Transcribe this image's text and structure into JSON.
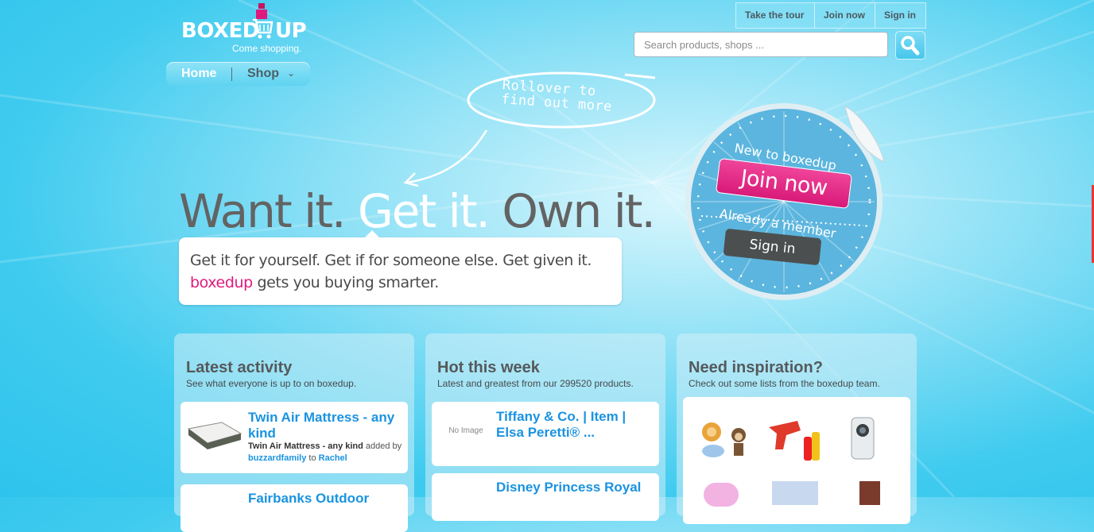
{
  "logo": {
    "word_left": "BOXED",
    "word_right": "UP",
    "tagline": "Come shopping."
  },
  "nav": {
    "home": "Home",
    "shop": "Shop"
  },
  "toplinks": {
    "tour": "Take the tour",
    "join": "Join now",
    "signin": "Sign in"
  },
  "search": {
    "placeholder": "Search products, shops ..."
  },
  "bubble": {
    "text": "Rollover to find out more"
  },
  "hero": {
    "headline_a": "Want it.",
    "headline_b": " Get it.",
    "headline_c": " Own it.",
    "line1": "Get it for yourself. Get if for someone else. Get given it.",
    "line2_brand": "boxedup",
    "line2_rest": " gets you buying smarter."
  },
  "badge": {
    "new": "New to boxedup",
    "join": "Join now",
    "member": "Already a member",
    "signin": "Sign in"
  },
  "panels": {
    "latest": {
      "title": "Latest activity",
      "subtitle": "See what everyone is up to on boxedup.",
      "items": [
        {
          "title": "Twin Air Mattress - any kind",
          "meta_item": "Twin Air Mattress - any kind",
          "meta_added": " added by ",
          "user": "buzzardfamily",
          "meta_to": " to ",
          "recipient": "Rachel"
        },
        {
          "title": "Fairbanks Outdoor"
        }
      ]
    },
    "hot": {
      "title": "Hot this week",
      "subtitle": "Latest and greatest from our 299520 products.",
      "items": [
        {
          "title": "Tiffany & Co. | Item | Elsa Peretti® ...",
          "image_text": "No Image"
        },
        {
          "title": "Disney Princess Royal"
        }
      ]
    },
    "inspiration": {
      "title": "Need inspiration?",
      "subtitle": "Check out some lists from the boxedup team."
    }
  },
  "colors": {
    "brand_pink": "#e0197d",
    "link_blue": "#1a93e0",
    "sky": "#2ec3ec"
  }
}
